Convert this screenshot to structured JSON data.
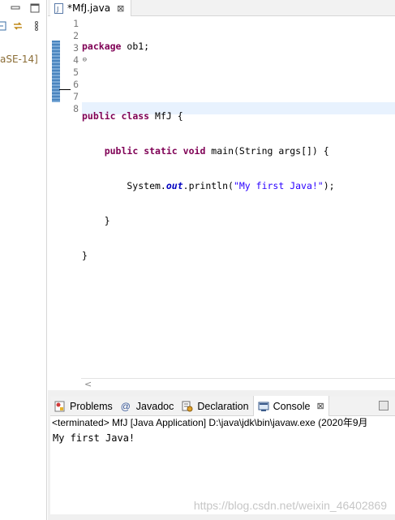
{
  "left_panel": {
    "project_label": "aSE-14]"
  },
  "editor": {
    "tab_title": "*MfJ.java",
    "line_numbers": [
      "1",
      "2",
      "3",
      "4",
      "5",
      "6",
      "7",
      "8"
    ],
    "code": {
      "l1_kw": "package",
      "l1_rest": " ob1;",
      "l3_kw1": "public",
      "l3_kw2": "class",
      "l3_rest": " MfJ {",
      "l4_indent": "    ",
      "l4_kw1": "public",
      "l4_kw2": "static",
      "l4_kw3": "void",
      "l4_rest": " main(String args[]) {",
      "l5_indent": "        System.",
      "l5_field": "out",
      "l5_mid": ".println(",
      "l5_str": "\"My first Java!\"",
      "l5_end": ");",
      "l6": "    }",
      "l7": "}"
    }
  },
  "console": {
    "tabs": [
      {
        "label": "Problems",
        "icon": "problems-icon"
      },
      {
        "label": "Javadoc",
        "icon": "javadoc-icon"
      },
      {
        "label": "Declaration",
        "icon": "declaration-icon"
      },
      {
        "label": "Console",
        "icon": "console-icon"
      }
    ],
    "status": "<terminated> MfJ [Java Application] D:\\java\\jdk\\bin\\javaw.exe  (2020年9月",
    "output": "My first Java!"
  },
  "watermark": "https://blog.csdn.net/weixin_46402869",
  "colors": {
    "keyword": "#7f0055",
    "string": "#2a00ff",
    "field": "#0000c0",
    "current_line": "#e8f2fe"
  }
}
